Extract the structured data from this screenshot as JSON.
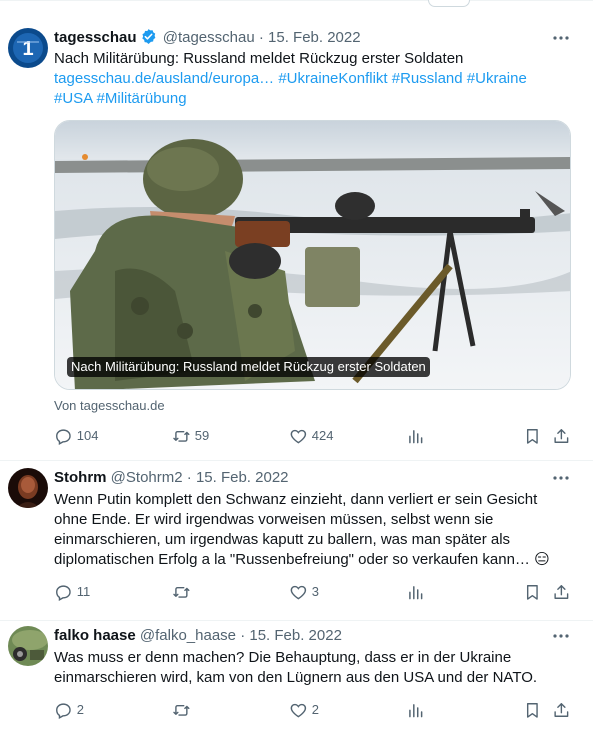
{
  "tweets": [
    {
      "name": "tagesschau",
      "handle": "@tagesschau",
      "separator": "·",
      "date": "15. Feb. 2022",
      "text_line": "Nach Militärübung: Russland meldet Rückzug erster Soldaten",
      "link": "tagesschau.de/ausland/europa…",
      "hashtags_line1": "#UkraineKonflikt #Russland #Ukraine",
      "hashtags_line2": "#USA #Militärübung",
      "card_caption": "Nach Militärübung: Russland meldet Rückzug erster Soldaten",
      "card_source": "Von tagesschau.de",
      "replies": "104",
      "retweets": "59",
      "likes": "424"
    },
    {
      "name": "Stohrm",
      "handle": "@Stohrm2",
      "separator": "·",
      "date": "15. Feb. 2022",
      "lines": [
        "Wenn Putin komplett den Schwanz einzieht, dann verliert er sein Gesicht",
        "ohne Ende. Er wird irgendwas vorweisen müssen, selbst wenn sie",
        "einmarschieren, um irgendwas kaputt zu ballern, was man später als",
        "diplomatischen Erfolg a la \"Russenbefreiung\" oder so verkaufen kann…"
      ],
      "emoji": "😑",
      "replies": "11",
      "likes": "3"
    },
    {
      "name": "falko haase",
      "handle": "@falko_haase",
      "separator": "·",
      "date": "15. Feb. 2022",
      "lines": [
        "Was muss er denn machen? Die Behauptung, dass er in der Ukraine",
        "einmarschieren wird, kam von den Lügnern aus den USA und der NATO."
      ],
      "replies": "2",
      "likes": "2"
    }
  ],
  "icons": {
    "verified": "verified-badge-icon",
    "more": "more-icon",
    "reply": "reply-icon",
    "retweet": "retweet-icon",
    "like": "like-icon",
    "views": "views-icon",
    "bookmark": "bookmark-icon",
    "share": "share-icon"
  },
  "colors": {
    "accent": "#1d9bf0",
    "secondary_text": "#536471",
    "divider": "#eff3f4"
  }
}
